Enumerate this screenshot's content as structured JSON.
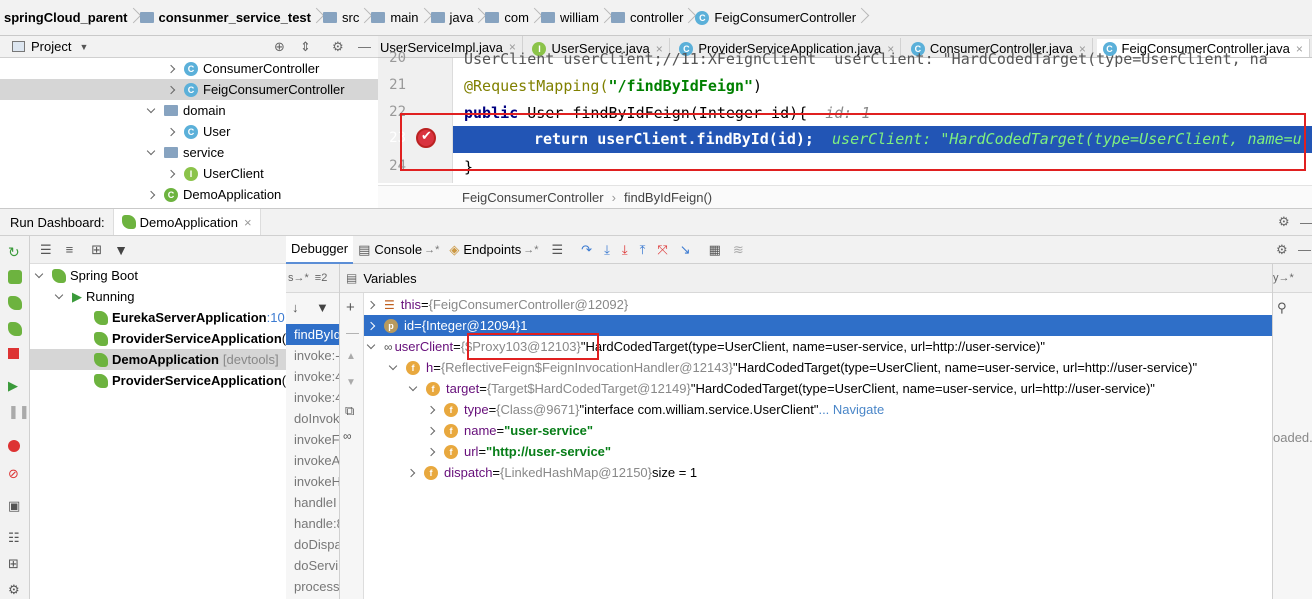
{
  "breadcrumb": [
    "springCloud_parent",
    "consunmer_service_test",
    "src",
    "main",
    "java",
    "com",
    "william",
    "controller",
    "FeigConsumerController"
  ],
  "project": {
    "label": "Project"
  },
  "editor_tabs": [
    {
      "label": "UserServiceImpl.java"
    },
    {
      "label": "UserService.java"
    },
    {
      "label": "ProviderServiceApplication.java"
    },
    {
      "label": "ConsumerController.java"
    },
    {
      "label": "FeigConsumerController.java"
    }
  ],
  "tree": {
    "consumer_controller": "ConsumerController",
    "feig_consumer_controller": "FeigConsumerController",
    "domain": "domain",
    "user": "User",
    "service": "service",
    "user_client": "UserClient",
    "demo_application": "DemoApplication"
  },
  "code": {
    "l20_num": "20",
    "l20": "UserClient userClient;//11:XFeignClient  userClient: \"HardCodedTarget(type=UserClient, na",
    "l21_num": "21",
    "l21_annotation": "@RequestMapping(",
    "l21_string": "\"/findByIdFeign\"",
    "l21_end": ")",
    "l22_num": "22",
    "l22_kw": "public",
    "l22_rest": " User findByIdFeign(Integer id){",
    "l22_hint": "id: 1",
    "l23_num": "23",
    "l23_kw": "return",
    "l23_rest": " userClient.findById(id);",
    "l23_hint": "userClient: \"HardCodedTarget(type=UserClient, name=u",
    "l24_num": "24",
    "l24": "}"
  },
  "editor_breadcrumb": {
    "cls": "FeigConsumerController",
    "method": "findByIdFeign()"
  },
  "run": {
    "title": "Run Dashboard:",
    "tab": "DemoApplication"
  },
  "services": {
    "spring_boot": "Spring Boot",
    "running": "Running",
    "apps": [
      {
        "name": "EurekaServerApplication",
        "extra": ":10"
      },
      {
        "name": "ProviderServiceApplication",
        "extra": "("
      },
      {
        "name": "DemoApplication",
        "extra": "[devtools]"
      },
      {
        "name": "ProviderServiceApplication",
        "extra": "("
      }
    ]
  },
  "debugger_tabs": {
    "debugger": "Debugger",
    "console": "Console",
    "console_arrow": "→*",
    "endpoints": "Endpoints",
    "endpoints_arrow": "→*"
  },
  "frames": [
    "findById",
    "invoke:-",
    "invoke:4",
    "invoke:4",
    "doInvok",
    "invokeF",
    "invokeA",
    "invokeH",
    "handleI",
    "handle:8",
    "doDispa",
    "doServi",
    "process"
  ],
  "frames_header": "s→*",
  "variables": {
    "header": "Variables",
    "rows": [
      {
        "name": "this",
        "eq": " = ",
        "ref": "{FeigConsumerController@12092}",
        "val": ""
      },
      {
        "name": "id",
        "eq": " = ",
        "ref": "{Integer@12094}",
        "val": " 1"
      },
      {
        "name": "userClient",
        "eq": " = ",
        "ref": "{$Proxy103@12103}",
        "val": " \"HardCodedTarget(type=UserClient, name=user-service, url=http://user-service)\""
      },
      {
        "name": "h",
        "eq": " = ",
        "ref": "{ReflectiveFeign$FeignInvocationHandler@12143}",
        "val": " \"HardCodedTarget(type=UserClient, name=user-service, url=http://user-service)\""
      },
      {
        "name": "target",
        "eq": " = ",
        "ref": "{Target$HardCodedTarget@12149}",
        "val": " \"HardCodedTarget(type=UserClient, name=user-service, url=http://user-service)\""
      },
      {
        "name": "type",
        "eq": " = ",
        "ref": "{Class@9671}",
        "val": " \"interface com.william.service.UserClient\"",
        "link": "... Navigate"
      },
      {
        "name": "name",
        "eq": " = ",
        "ref": "",
        "val": "\"user-service\""
      },
      {
        "name": "url",
        "eq": " = ",
        "ref": "",
        "val": "\"http://user-service\""
      },
      {
        "name": "dispatch",
        "eq": " = ",
        "ref": "{LinkedHashMap@12150}",
        "val": "  size = 1"
      }
    ]
  },
  "right_panel": {
    "header": "y→*",
    "text": "oaded."
  }
}
